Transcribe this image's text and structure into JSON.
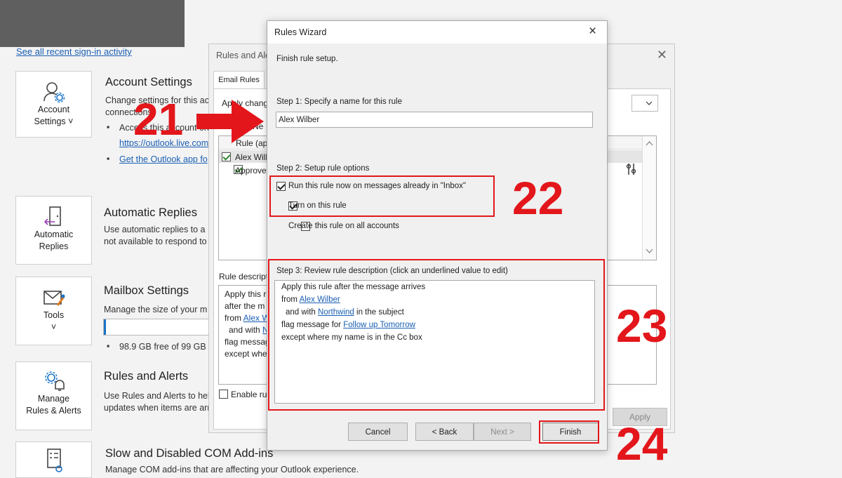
{
  "background": {
    "signin_link": "See all recent sign-in activity",
    "sections": [
      {
        "tile_label_1": "Account",
        "tile_label_2": "Settings ˅",
        "title": "Account Settings",
        "desc_1": "Change settings for this ac",
        "desc_2": "connections.",
        "bullet_1": "Access this account on",
        "link_1": "https://outlook.live.com",
        "link_2": "Get the Outlook app fo"
      },
      {
        "tile_label_1": "Automatic",
        "tile_label_2": "Replies",
        "title": "Automatic Replies",
        "desc_1": "Use automatic replies to a",
        "desc_2": "not available to respond to"
      },
      {
        "tile_label_1": "Tools",
        "tile_label_2": "˅",
        "title": "Mailbox Settings",
        "desc_1": "Manage the size of your m",
        "bullet_1": "98.9 GB free of 99 GB",
        "progress": 0.02
      },
      {
        "tile_label_1": "Manage",
        "tile_label_2": "Rules & Alerts",
        "title": "Rules and Alerts",
        "desc_1": "Use Rules and Alerts to hel",
        "desc_2": "updates when items are arr"
      },
      {
        "title": "Slow and Disabled COM Add-ins",
        "desc_1": "Manage COM add-ins that are affecting your Outlook experience."
      }
    ]
  },
  "rules_alerts": {
    "title": "Rules and Ale",
    "tab": "Email Rules",
    "apply_changes": "Apply change",
    "new_rule": "Ne",
    "column_header": "Rule (app",
    "rule_1": "Alex Wilb",
    "rule_2": "Approve",
    "desc_label": "Rule descript",
    "desc_1": "Apply this ru",
    "desc_2": "after the m",
    "desc_3_prefix": "from ",
    "desc_3_link": "Alex W",
    "desc_4_prefix": "and with ",
    "desc_4_link": "N",
    "desc_5": "flag messag",
    "desc_6": "except wher",
    "enable_rules": "Enable rule",
    "apply_button": "Apply"
  },
  "wizard": {
    "title": "Rules Wizard",
    "close_icon": "×",
    "heading": "Finish rule setup.",
    "step1_label": "Step 1: Specify a name for this rule",
    "rule_name": "Alex Wilber",
    "step2_label": "Step 2: Setup rule options",
    "option_run_now": "Run this rule now on messages already in \"Inbox\"",
    "option_turn_on": "Turn on this rule",
    "option_all_accounts": "Create this rule on all accounts",
    "step3_label": "Step 3: Review rule description (click an underlined value to edit)",
    "desc_line_1": "Apply this rule after the message arrives",
    "desc_line_2_prefix": "from ",
    "desc_line_2_link": "Alex Wilber",
    "desc_line_3_prefix": "and with ",
    "desc_line_3_link": "Northwind",
    "desc_line_3_suffix": " in the subject",
    "desc_line_4_prefix": "flag message for ",
    "desc_line_4_link": "Follow up Tomorrow",
    "desc_line_5": "except where my name is in the Cc box",
    "cancel": "Cancel",
    "back": "< Back",
    "next": "Next >",
    "finish": "Finish"
  },
  "annotations": {
    "step_21": "21",
    "step_22": "22",
    "step_23": "23",
    "step_24": "24",
    "color": "#e3161b"
  }
}
